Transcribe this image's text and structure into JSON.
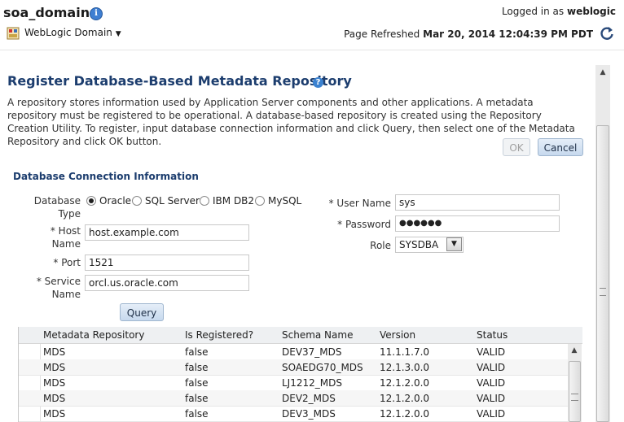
{
  "header": {
    "domain_title": "soa_domain",
    "logged_in_prefix": "Logged in as",
    "user": "weblogic",
    "domain_menu": "WebLogic Domain",
    "refresh_prefix": "Page Refreshed",
    "refresh_time": "Mar 20, 2014 12:04:39 PM PDT"
  },
  "page": {
    "title": "Register Database-Based Metadata Repository",
    "description": "A repository stores information used by Application Server components and other applications. A metadata repository must be registered to be operational. A database-based repository is created using the Repository Creation Utility. To register, input database connection information and click Query, then select one of the Metadata Repository and click OK button.",
    "ok_label": "OK",
    "cancel_label": "Cancel"
  },
  "form": {
    "section_title": "Database Connection Information",
    "db_type_label_1": "Database",
    "db_type_label_2": "Type",
    "db_types": [
      "Oracle",
      "SQL Server",
      "IBM DB2",
      "MySQL"
    ],
    "selected_db_type": "Oracle",
    "host_label_1": "* Host",
    "host_label_2": "Name",
    "host_value": "host.example.com",
    "port_label": "* Port",
    "port_value": "1521",
    "service_label_1": "* Service",
    "service_label_2": "Name",
    "service_value": "orcl.us.oracle.com",
    "user_label": "* User Name",
    "user_value": "sys",
    "password_label": "* Password",
    "password_value": "●●●●●●",
    "role_label": "Role",
    "role_value": "SYSDBA",
    "query_label": "Query"
  },
  "table": {
    "columns": [
      "Metadata Repository",
      "Is Registered?",
      "Schema Name",
      "Version",
      "Status"
    ],
    "rows": [
      [
        "MDS",
        "false",
        "DEV37_MDS",
        "11.1.1.7.0",
        "VALID"
      ],
      [
        "MDS",
        "false",
        "SOAEDG70_MDS",
        "12.1.3.0.0",
        "VALID"
      ],
      [
        "MDS",
        "false",
        "LJ1212_MDS",
        "12.1.2.0.0",
        "VALID"
      ],
      [
        "MDS",
        "false",
        "DEV2_MDS",
        "12.1.2.0.0",
        "VALID"
      ],
      [
        "MDS",
        "false",
        "DEV3_MDS",
        "12.1.2.0.0",
        "VALID"
      ]
    ]
  },
  "icons": {
    "info": "info-icon",
    "help": "help-icon",
    "refresh": "refresh-icon",
    "weblogic": "weblogic-domain-icon"
  }
}
